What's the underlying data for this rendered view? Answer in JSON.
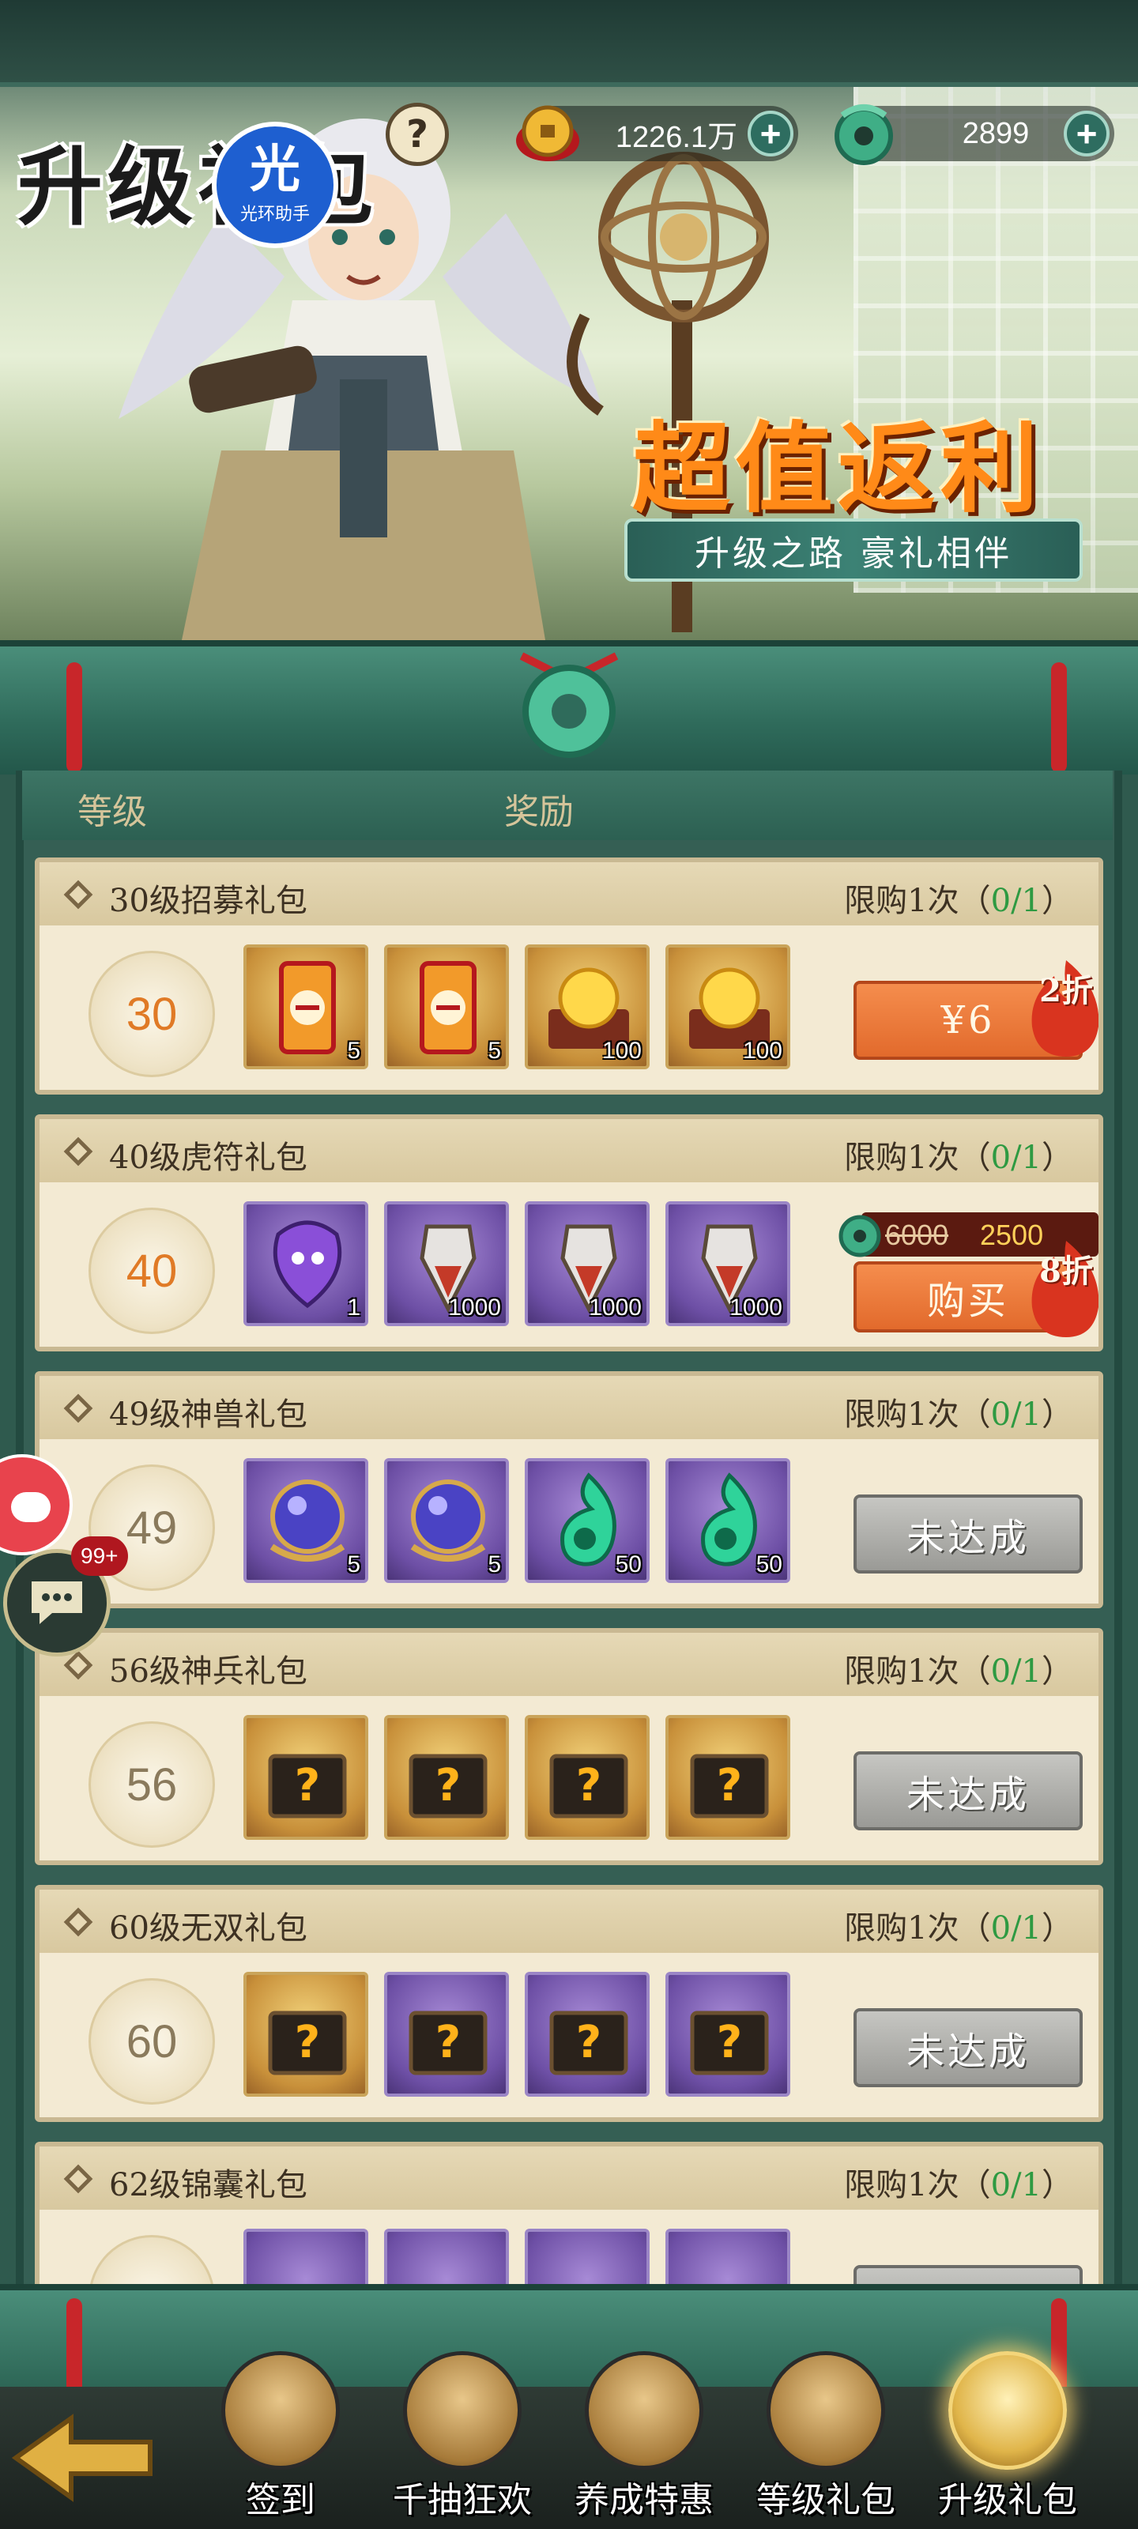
{
  "header": {
    "title": "升级礼包",
    "app_badge_main": "光",
    "app_badge_sub": "光环助手",
    "help_label": "?",
    "gold_currency": "1226.1万",
    "jade_currency": "2899",
    "add_label": "+"
  },
  "banner": {
    "slogan": "超值返利",
    "subtitle": "升级之路 豪礼相伴"
  },
  "table": {
    "col_level": "等级",
    "col_reward": "奖励"
  },
  "rows": [
    {
      "title": "30级招募礼包",
      "limit_prefix": "限购1次（",
      "limit_count": "0/1",
      "limit_suffix": "）",
      "level": "30",
      "items": [
        {
          "icon": "recruit-token-icon",
          "qty": "5",
          "bg": "gold"
        },
        {
          "icon": "recruit-token-icon",
          "qty": "5",
          "bg": "gold"
        },
        {
          "icon": "golden-orb-chest-icon",
          "qty": "100",
          "bg": "gold"
        },
        {
          "icon": "golden-orb-chest-icon",
          "qty": "100",
          "bg": "gold"
        }
      ],
      "button": "¥6",
      "button_style": "orange",
      "discount": "2折"
    },
    {
      "title": "40级虎符礼包",
      "limit_prefix": "限购1次（",
      "limit_count": "0/1",
      "limit_suffix": "）",
      "level": "40",
      "items": [
        {
          "icon": "purple-tiger-seal-icon",
          "qty": "1",
          "bg": "purple"
        },
        {
          "icon": "tiger-tally-icon",
          "qty": "1000",
          "bg": "purple"
        },
        {
          "icon": "tiger-tally-icon",
          "qty": "1000",
          "bg": "purple"
        },
        {
          "icon": "tiger-tally-icon",
          "qty": "1000",
          "bg": "purple"
        }
      ],
      "price_old": "6000",
      "price_new": "2500",
      "button": "购买",
      "button_style": "orange",
      "discount": "8折"
    },
    {
      "title": "49级神兽礼包",
      "limit_prefix": "限购1次（",
      "limit_count": "0/1",
      "limit_suffix": "）",
      "level": "49",
      "items": [
        {
          "icon": "beast-orb-icon",
          "qty": "5",
          "bg": "purple"
        },
        {
          "icon": "beast-orb-icon",
          "qty": "5",
          "bg": "purple"
        },
        {
          "icon": "green-spirit-flame-icon",
          "qty": "50",
          "bg": "purple"
        },
        {
          "icon": "green-spirit-flame-icon",
          "qty": "50",
          "bg": "purple"
        }
      ],
      "button": "未达成",
      "button_style": "gray"
    },
    {
      "title": "56级神兵礼包",
      "limit_prefix": "限购1次（",
      "limit_count": "0/1",
      "limit_suffix": "）",
      "level": "56",
      "items": [
        {
          "icon": "mystery-chest-icon",
          "qty": "",
          "bg": "gold"
        },
        {
          "icon": "mystery-chest-icon",
          "qty": "",
          "bg": "gold"
        },
        {
          "icon": "mystery-chest-icon",
          "qty": "",
          "bg": "gold"
        },
        {
          "icon": "mystery-chest-icon",
          "qty": "",
          "bg": "gold"
        }
      ],
      "button": "未达成",
      "button_style": "gray"
    },
    {
      "title": "60级无双礼包",
      "limit_prefix": "限购1次（",
      "limit_count": "0/1",
      "limit_suffix": "）",
      "level": "60",
      "items": [
        {
          "icon": "mystery-chest-icon",
          "qty": "",
          "bg": "gold"
        },
        {
          "icon": "mystery-chest-icon",
          "qty": "",
          "bg": "purple"
        },
        {
          "icon": "mystery-chest-icon",
          "qty": "",
          "bg": "purple"
        },
        {
          "icon": "mystery-chest-icon",
          "qty": "",
          "bg": "purple"
        }
      ],
      "button": "未达成",
      "button_style": "gray"
    },
    {
      "title": "62级锦囊礼包",
      "limit_prefix": "限购1次（",
      "limit_count": "0/1",
      "limit_suffix": "）",
      "level": "",
      "items": [
        {
          "icon": "mystery-chest-icon",
          "qty": "",
          "bg": "purple"
        },
        {
          "icon": "mystery-chest-icon",
          "qty": "",
          "bg": "purple"
        },
        {
          "icon": "mystery-chest-icon",
          "qty": "",
          "bg": "purple"
        },
        {
          "icon": "mystery-chest-icon",
          "qty": "",
          "bg": "purple"
        }
      ],
      "button": "",
      "button_style": "gray"
    }
  ],
  "floating": {
    "chat_badge": "99+"
  },
  "nav": {
    "tabs": [
      {
        "label": "签到",
        "icon": "sign-in-scroll-icon"
      },
      {
        "label": "千抽狂欢",
        "icon": "thousand-draw-icon"
      },
      {
        "label": "养成特惠",
        "icon": "training-deal-chest-icon"
      },
      {
        "label": "等级礼包",
        "icon": "level-gift-bag-icon"
      },
      {
        "label": "升级礼包",
        "icon": "upgrade-gift-pot-icon"
      }
    ],
    "active_index": 4
  },
  "colors": {
    "accent_orange": "#e26a2c",
    "frame_green": "#2f6b5b",
    "limit_green": "#2e9a42"
  }
}
